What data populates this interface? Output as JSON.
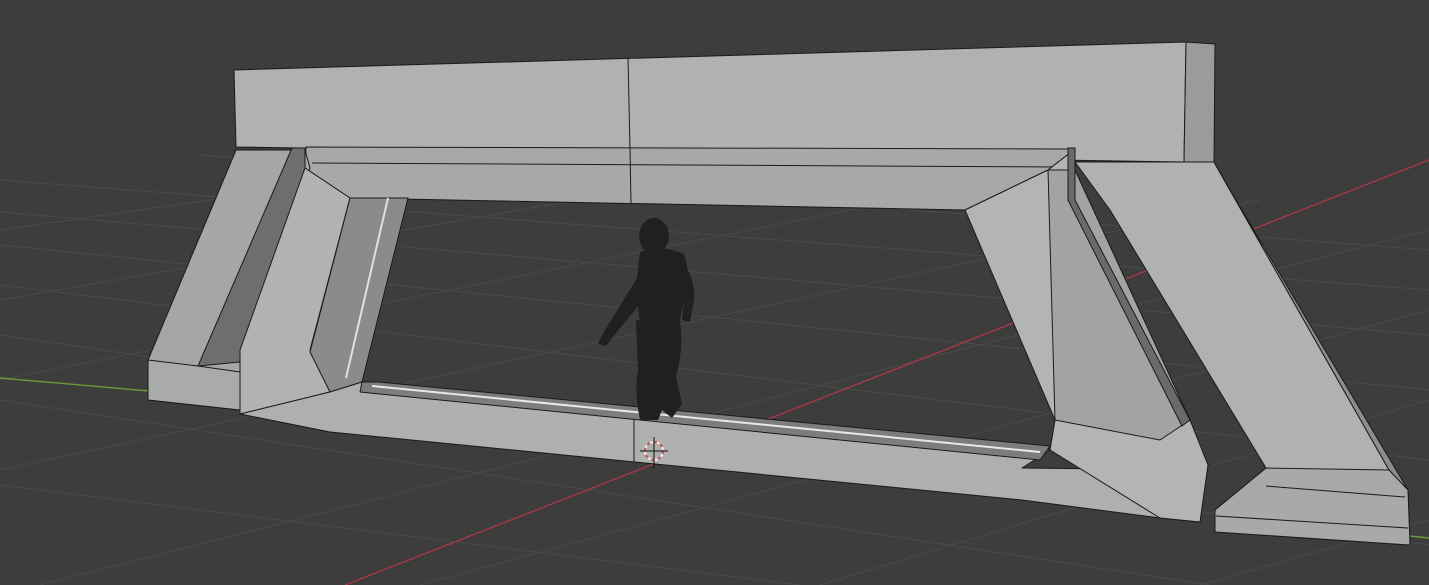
{
  "app": {
    "name": "3D viewport",
    "view": "perspective",
    "shading": "solid"
  },
  "colors": {
    "background": "#3d3d3d",
    "grid_line": "#4a4a4a",
    "x_axis": "#a63a44",
    "y_axis": "#6a9a3a",
    "mesh_face": "#a9abab",
    "mesh_face_light": "#b4b6b6",
    "mesh_face_shadow": "#6f6e6d",
    "mesh_face_dark": "#8a8b8b",
    "mesh_edge": "#1a1a1a",
    "character": "#202020",
    "cursor_red": "#d24a4a",
    "cursor_white": "#f0f0f0"
  },
  "scene": {
    "objects": [
      {
        "name": "gate_frame",
        "type": "mesh"
      },
      {
        "name": "character",
        "type": "mesh"
      }
    ],
    "overlays": [
      "grid_floor",
      "x_axis_line",
      "y_axis_line",
      "3d_cursor"
    ]
  }
}
